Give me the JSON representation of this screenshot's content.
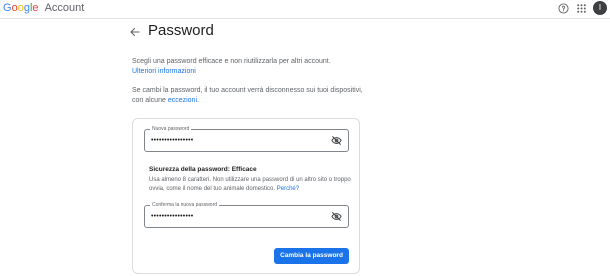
{
  "header": {
    "logo_letters": [
      "G",
      "o",
      "o",
      "g",
      "l",
      "e"
    ],
    "logo_colors": [
      "#4285F4",
      "#EA4335",
      "#FBBC05",
      "#4285F4",
      "#34A853",
      "#EA4335"
    ],
    "account_label": "Account",
    "avatar_initial": "I"
  },
  "page": {
    "title": "Password",
    "intro_line": "Scegli una password efficace e non riutilizzarla per altri account.",
    "intro_link": "Ulteriori informazioni",
    "warning_line1": "Se cambi la password, il tuo account verrà disconnesso sui tuoi dispositivi,",
    "warning_line2_prefix": "con alcune",
    "warning_link": "eccezioni",
    "warning_line2_suffix": "."
  },
  "form": {
    "new_password_label": "Nuova password",
    "new_password_value": "••••••••••••••••",
    "strength_title": "Sicurezza della password: Efficace",
    "strength_line1": "Usa almeno 8 caratteri. Non utilizzare una password di un altro sito o troppo",
    "strength_line2": "ovvia, come il nome del tuo animale domestico.",
    "strength_link": "Perché?",
    "confirm_label": "Conferma la nuova password",
    "confirm_value": "••••••••••••••••",
    "submit_label": "Cambia la password"
  },
  "colors": {
    "accent": "#1a73e8",
    "text": "#3c4043"
  }
}
